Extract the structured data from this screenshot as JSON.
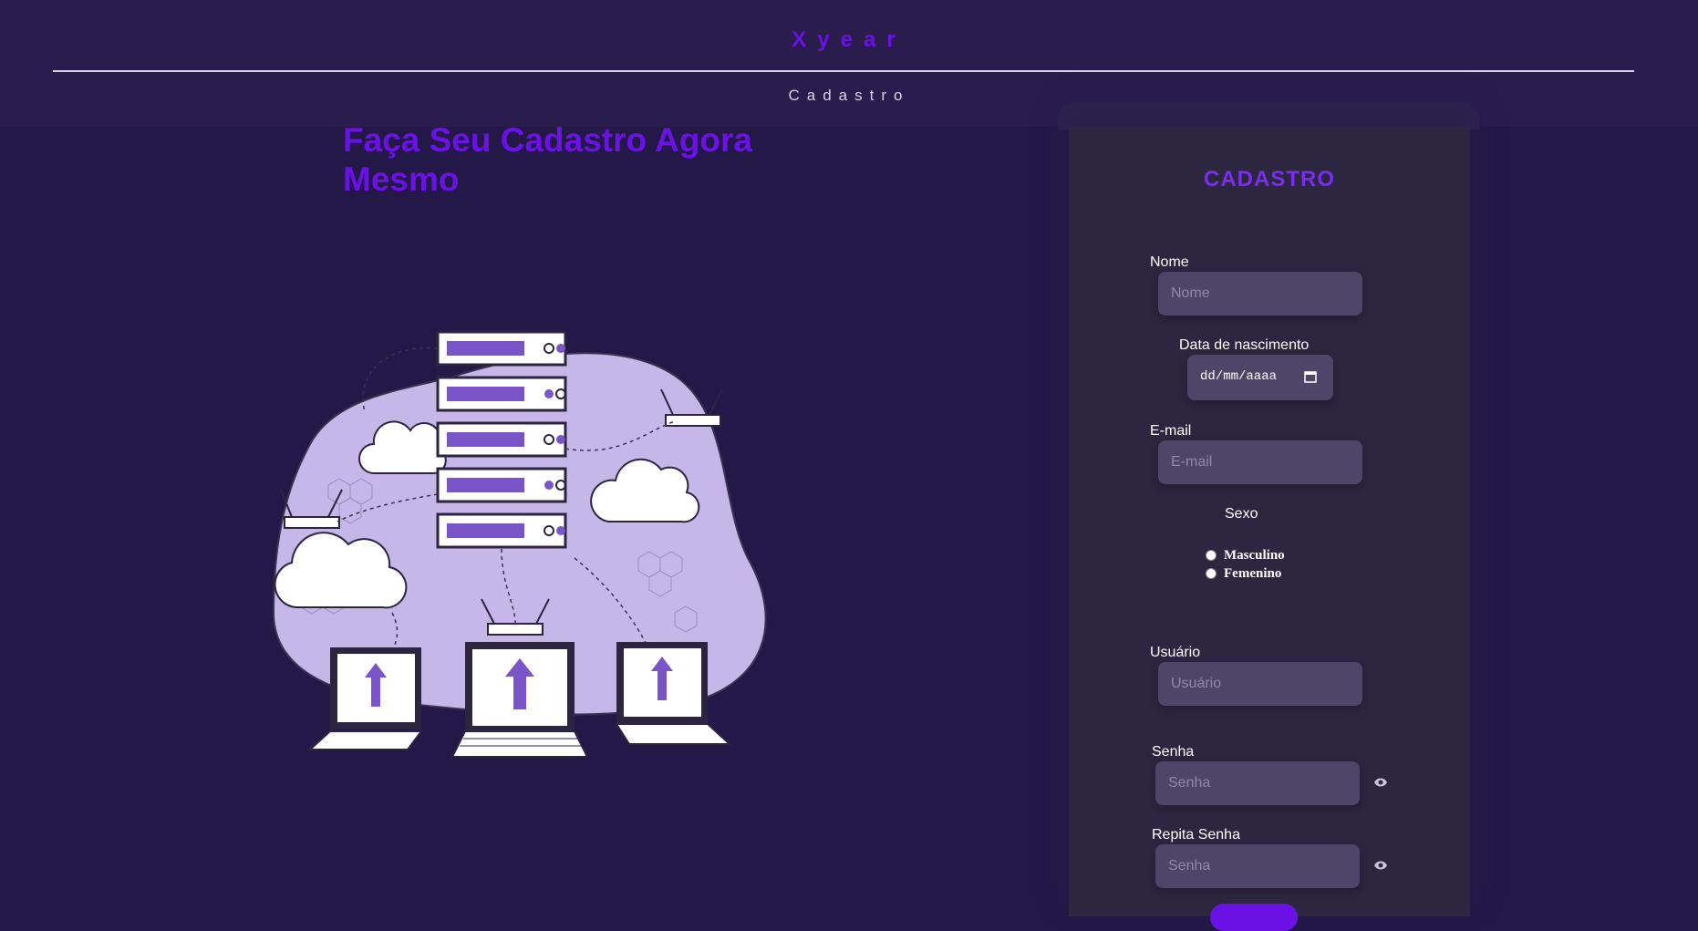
{
  "header": {
    "brand": "Xyear",
    "nav_link": "Cadastro"
  },
  "hero": {
    "title": "Faça Seu Cadastro Agora Mesmo"
  },
  "form": {
    "title": "CADASTRO",
    "name_label": "Nome",
    "name_placeholder": "Nome",
    "birth_label": "Data de nascimento",
    "birth_placeholder": "dd/mm/aaaa",
    "email_label": "E-mail",
    "email_placeholder": "E-mail",
    "sex_label": "Sexo",
    "sex_options": [
      "Masculino",
      "Femenino"
    ],
    "user_label": "Usuário",
    "user_placeholder": "Usuário",
    "password_label": "Senha",
    "password_placeholder": "Senha",
    "repeat_password_label": "Repita Senha",
    "repeat_password_placeholder": "Senha"
  },
  "icons": {
    "eye": "eye-icon",
    "calendar": "calendar-icon"
  },
  "colors": {
    "background": "#241848",
    "header": "#2a1d4e",
    "accent": "#6a12e6",
    "panel": "#2c2640",
    "input": "#4e4668"
  }
}
